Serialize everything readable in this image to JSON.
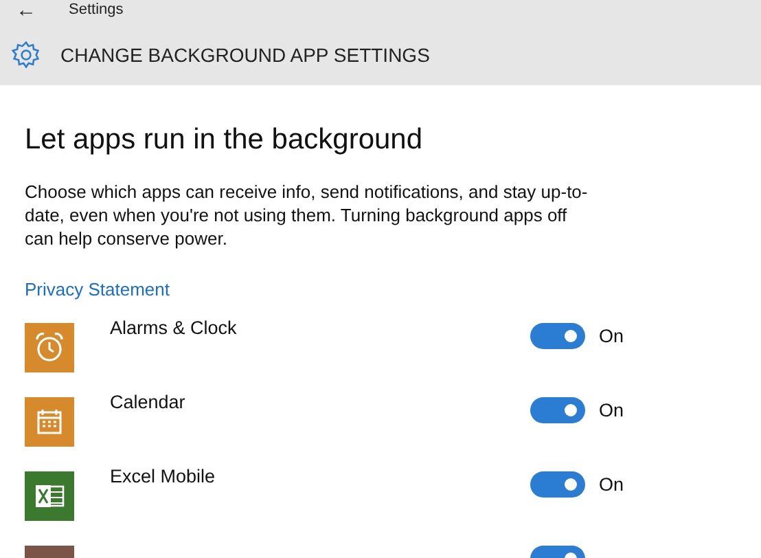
{
  "header": {
    "back": "←",
    "title": "Settings",
    "page_title": "CHANGE BACKGROUND APP SETTINGS"
  },
  "heading": "Let apps run in the background",
  "description": "Choose which apps can receive info, send notifications, and stay up-to-date, even when you're not using them. Turning background apps off can help conserve power.",
  "link": "Privacy Statement",
  "apps": [
    {
      "kind": "alarm",
      "color": "#d68a2b",
      "name": "Alarms & Clock",
      "on": true,
      "status": "On"
    },
    {
      "kind": "calendar",
      "color": "#d68a2b",
      "name": "Calendar",
      "on": true,
      "status": "On"
    },
    {
      "kind": "excel",
      "color": "#3b7a2e",
      "name": "Excel Mobile",
      "on": true,
      "status": "On"
    },
    {
      "kind": "plain",
      "color": "#7a5548",
      "on": true
    }
  ]
}
